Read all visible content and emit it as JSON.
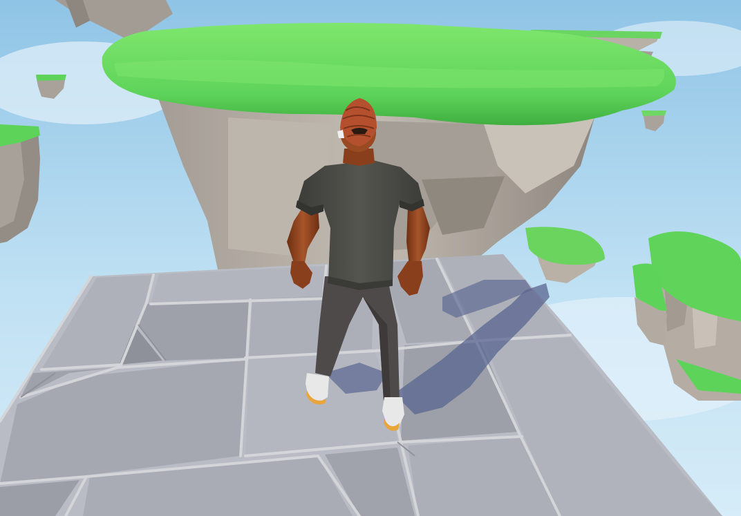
{
  "scene": {
    "colors": {
      "sky_top": "#8fc4e6",
      "sky_mid": "#bfe0f3",
      "sky_low": "#d6ecf8",
      "grass": "#5ed35a",
      "grass_dark": "#3fae3f",
      "grass_light": "#7fe66d",
      "rock": "#b3aca4",
      "rock_dark": "#8e877f",
      "rock_light": "#cfc8bf",
      "tile": "#a8aab2",
      "tile_light": "#bfc2ca",
      "tile_dark": "#8d9098",
      "grout": "#d0d2d6",
      "shadow": "#5a6590",
      "skin": "#9a4a22",
      "skin_dark": "#6e2f12",
      "hair": "#b5502e",
      "shirt": "#4a4a46",
      "pants": "#4e4a4a",
      "shoe": "#e8e8e8",
      "sole": "#e9a53a"
    },
    "elements": [
      "sky",
      "floating-island-large",
      "floating-island-left",
      "floating-island-right",
      "floating-island-small",
      "stone-tile-platform",
      "player-character",
      "player-shadow"
    ]
  }
}
